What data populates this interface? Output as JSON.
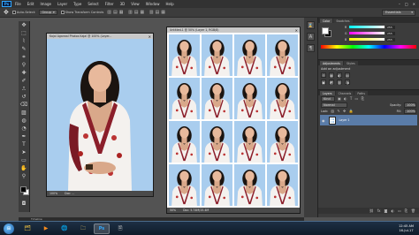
{
  "app": {
    "logo": "Ps"
  },
  "menu": {
    "items": [
      "File",
      "Edit",
      "Image",
      "Layer",
      "Type",
      "Select",
      "Filter",
      "3D",
      "View",
      "Window",
      "Help"
    ]
  },
  "window_controls": {
    "minimize": "–",
    "maximize": "□",
    "close": "✕"
  },
  "options": {
    "auto_select_label": "Auto-Select:",
    "auto_select_value": "Group",
    "transform_label": "Show Transform Controls",
    "workspace": "Essentials"
  },
  "documents": {
    "left": {
      "title": "Kajal Agarwal Photos Kajal @ 100% (Layer...",
      "zoom": "100%",
      "doc_size": "Doc: ..."
    },
    "right": {
      "title": "Untitled-1 @ 50% (Layer 1, RGB/8)",
      "zoom": "50%",
      "doc_size": "Doc: 5.74M/15.4M"
    }
  },
  "photo_grid": {
    "rows": 4,
    "columns": 4
  },
  "color_panel": {
    "tabs": [
      "Color",
      "Swatches"
    ],
    "sliders": [
      {
        "label": "R",
        "value": "255"
      },
      {
        "label": "G",
        "value": "255"
      },
      {
        "label": "B",
        "value": "255"
      }
    ]
  },
  "adjustments_panel": {
    "tabs": [
      "Adjustments",
      "Styles"
    ],
    "heading": "Add an adjustment",
    "icons": [
      "☼",
      "▦",
      "◐",
      "▤",
      "▣",
      "◩",
      "▥",
      "◑"
    ]
  },
  "layers_panel": {
    "tabs": [
      "Layers",
      "Channels",
      "Paths"
    ],
    "kind_label": "Kind",
    "blend_mode": "Normal",
    "opacity_label": "Opacity:",
    "opacity_value": "100%",
    "lock_label": "Lock:",
    "fill_label": "Fill:",
    "fill_value": "100%",
    "layer_name": "Layer 1"
  },
  "timeline": {
    "label": "Timeline"
  },
  "taskbar": {
    "apps": [
      "🗂",
      "▶",
      "🌐",
      "🗀",
      "Ps",
      "🗎"
    ],
    "active_index": 4,
    "time": "12:45 AM",
    "date": "16-Jul-17"
  },
  "colors": {
    "ps_blue": "#31a8ff",
    "photo_bg": "#a9cdee",
    "layer_selected": "#5a7ca8"
  }
}
